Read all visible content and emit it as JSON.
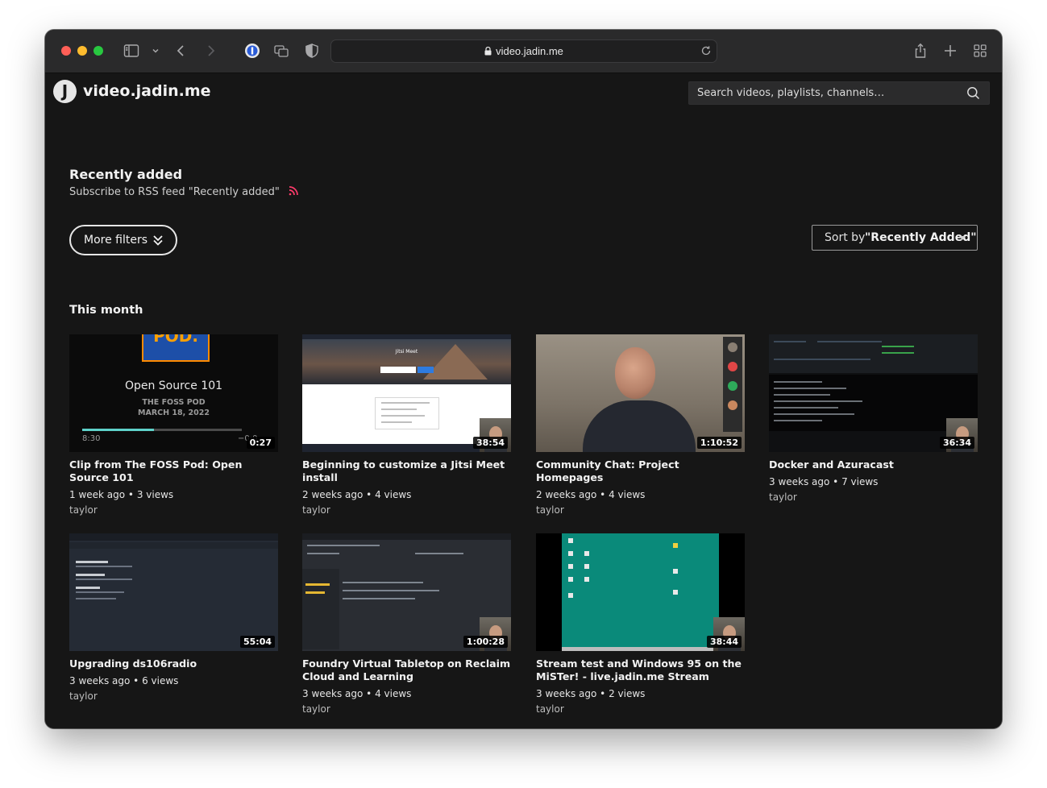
{
  "browser": {
    "url": "video.jadin.me"
  },
  "site": {
    "logo_letter": "J",
    "name": "video.jadin.me",
    "search_placeholder": "Search videos, playlists, channels…"
  },
  "section": {
    "title": "Recently added",
    "rss_text": "Subscribe to RSS feed \"Recently added\"",
    "rss_color": "#ff3b6b"
  },
  "controls": {
    "more_filters": "More filters",
    "sort_label": "Sort by",
    "sort_value": "\"Recently Added\""
  },
  "group_title": "This month",
  "videos": [
    {
      "title": "Clip from The FOSS Pod: Open Source 101",
      "meta": "1 week ago • 3 views",
      "channel": "taylor",
      "duration": "0:27",
      "thumb_text": {
        "pod": "POD.",
        "headline": "Open Source 101",
        "podcast": "THE FOSS POD",
        "date": "MARCH 18, 2022",
        "time_start": "8:30",
        "time_end": "−0:0"
      }
    },
    {
      "title": "Beginning to customize a Jitsi Meet install",
      "meta": "2 weeks ago • 4 views",
      "channel": "taylor",
      "duration": "38:54",
      "thumb_text": {
        "app": "Jitsi Meet"
      }
    },
    {
      "title": "Community Chat: Project Homepages",
      "meta": "2 weeks ago • 4 views",
      "channel": "taylor",
      "duration": "1:10:52"
    },
    {
      "title": "Docker and Azuracast",
      "meta": "3 weeks ago • 7 views",
      "channel": "taylor",
      "duration": "36:34"
    },
    {
      "title": "Upgrading ds106radio",
      "meta": "3 weeks ago • 6 views",
      "channel": "taylor",
      "duration": "55:04"
    },
    {
      "title": "Foundry Virtual Tabletop on Reclaim Cloud and Learning",
      "meta": "3 weeks ago • 4 views",
      "channel": "taylor",
      "duration": "1:00:28"
    },
    {
      "title": "Stream test and Windows 95 on the MiSTer! - live.jadin.me Stream",
      "meta": "3 weeks ago • 2 views",
      "channel": "taylor",
      "duration": "38:44"
    }
  ]
}
